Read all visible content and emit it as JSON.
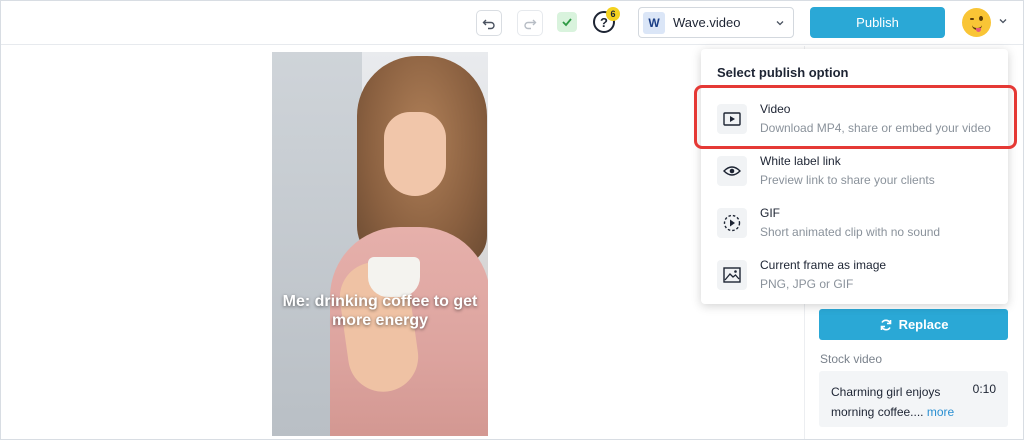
{
  "toolbar": {
    "undo_icon": "undo-icon",
    "redo_icon": "redo-icon",
    "saved_icon": "check-icon",
    "help_icon": "question-icon",
    "help_badge": "6",
    "workspace": {
      "logo_letter": "W",
      "name": "Wave.video"
    },
    "publish_label": "Publish",
    "avatar_icon": "winking-emoji-avatar"
  },
  "canvas": {
    "caption": "Me: drinking coffee to get more energy"
  },
  "publish_menu": {
    "title": "Select publish option",
    "options": [
      {
        "title": "Video",
        "subtitle": "Download MP4, share or embed your video",
        "icon": "video-play-icon",
        "highlighted": true
      },
      {
        "title": "White label link",
        "subtitle": "Preview link to share your clients",
        "icon": "eye-icon"
      },
      {
        "title": "GIF",
        "subtitle": "Short animated clip with no sound",
        "icon": "gif-play-icon"
      },
      {
        "title": "Current frame as image",
        "subtitle": "PNG, JPG or GIF",
        "icon": "image-icon"
      }
    ]
  },
  "right_panel": {
    "replace_label": "Replace",
    "stock_label": "Stock video",
    "stock_title": "Charming girl enjoys morning coffee....",
    "stock_more": "more",
    "stock_duration": "0:10"
  },
  "colors": {
    "accent": "#2aa8d6",
    "highlight": "#e53935",
    "badge": "#f4d21f"
  }
}
